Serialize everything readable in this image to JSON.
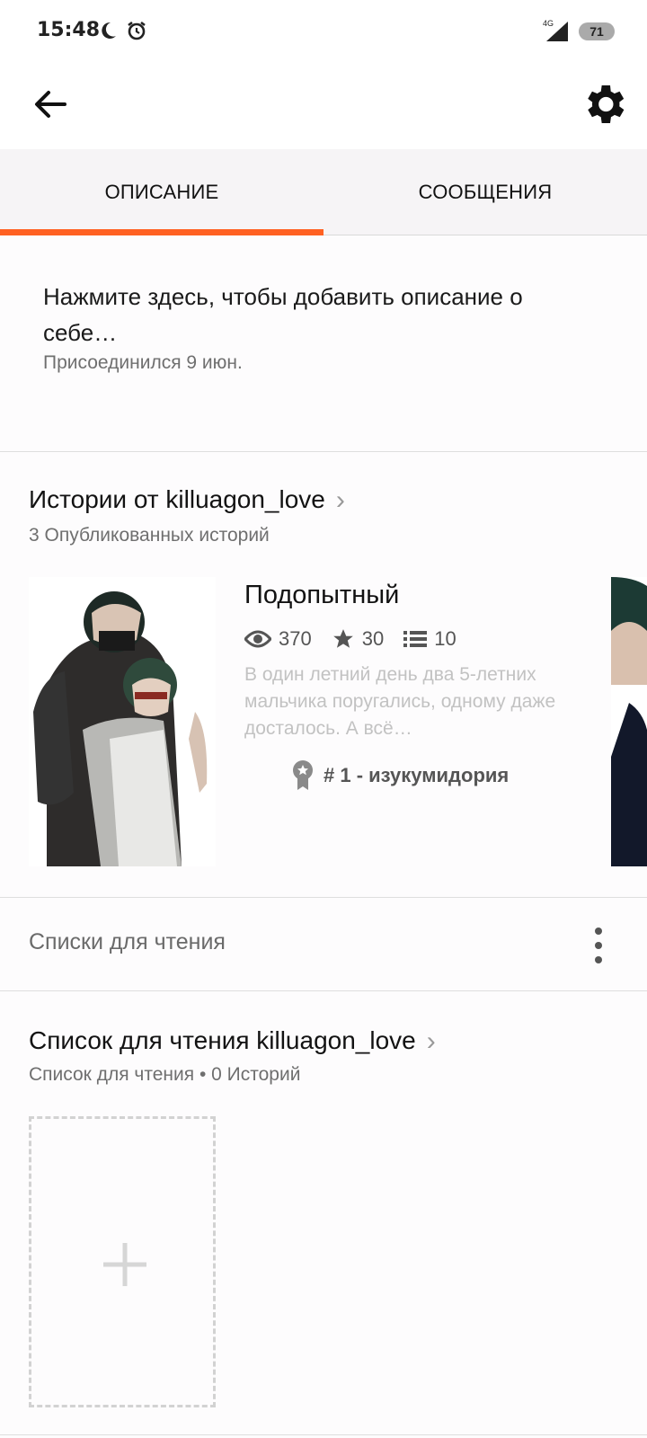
{
  "status_bar": {
    "time": "15:48",
    "network": "4G",
    "battery": "71"
  },
  "toolbar": {
    "back_icon": "arrow-left-icon",
    "settings_icon": "gear-icon"
  },
  "tabs": [
    {
      "label": "ОПИСАНИЕ",
      "active": true
    },
    {
      "label": "СООБЩЕНИЯ",
      "active": false
    }
  ],
  "about": {
    "placeholder": "Нажмите здесь, чтобы добавить описание о себе…",
    "joined": "Присоединился 9 июн."
  },
  "stories_section": {
    "title": "Истории от killuagon_love",
    "subtitle": "3 Опубликованных историй",
    "stories": [
      {
        "title": "Подопытный",
        "reads": "370",
        "votes": "30",
        "parts": "10",
        "description": "В один летний день два 5-летних мальчика поругались, одному даже досталось. А всё…",
        "rank": "# 1 - изукумидория"
      }
    ]
  },
  "reading_lists": {
    "label": "Списки для чтения"
  },
  "reading_list_section": {
    "title": "Список для чтения killuagon_love",
    "subtitle": "Список для чтения • 0 Историй"
  },
  "colors": {
    "accent": "#ff6122",
    "text_primary": "#121212",
    "text_secondary": "#6f6f6f"
  }
}
